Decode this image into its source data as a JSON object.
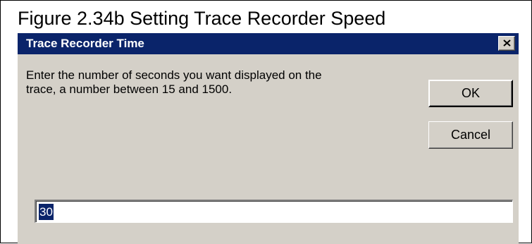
{
  "figure": {
    "caption": "Figure 2.34b Setting Trace Recorder Speed"
  },
  "dialog": {
    "title": "Trace Recorder Time",
    "close_icon": "close-x-icon",
    "prompt_line1": "Enter the number of seconds you want displayed on the",
    "prompt_line2": "trace, a number between 15 and 1500.",
    "ok_label": "OK",
    "cancel_label": "Cancel",
    "input_value": "30"
  },
  "colors": {
    "title_bar": "#0a246a",
    "dialog_bg": "#d4d0c8",
    "selection": "#0a246a"
  }
}
